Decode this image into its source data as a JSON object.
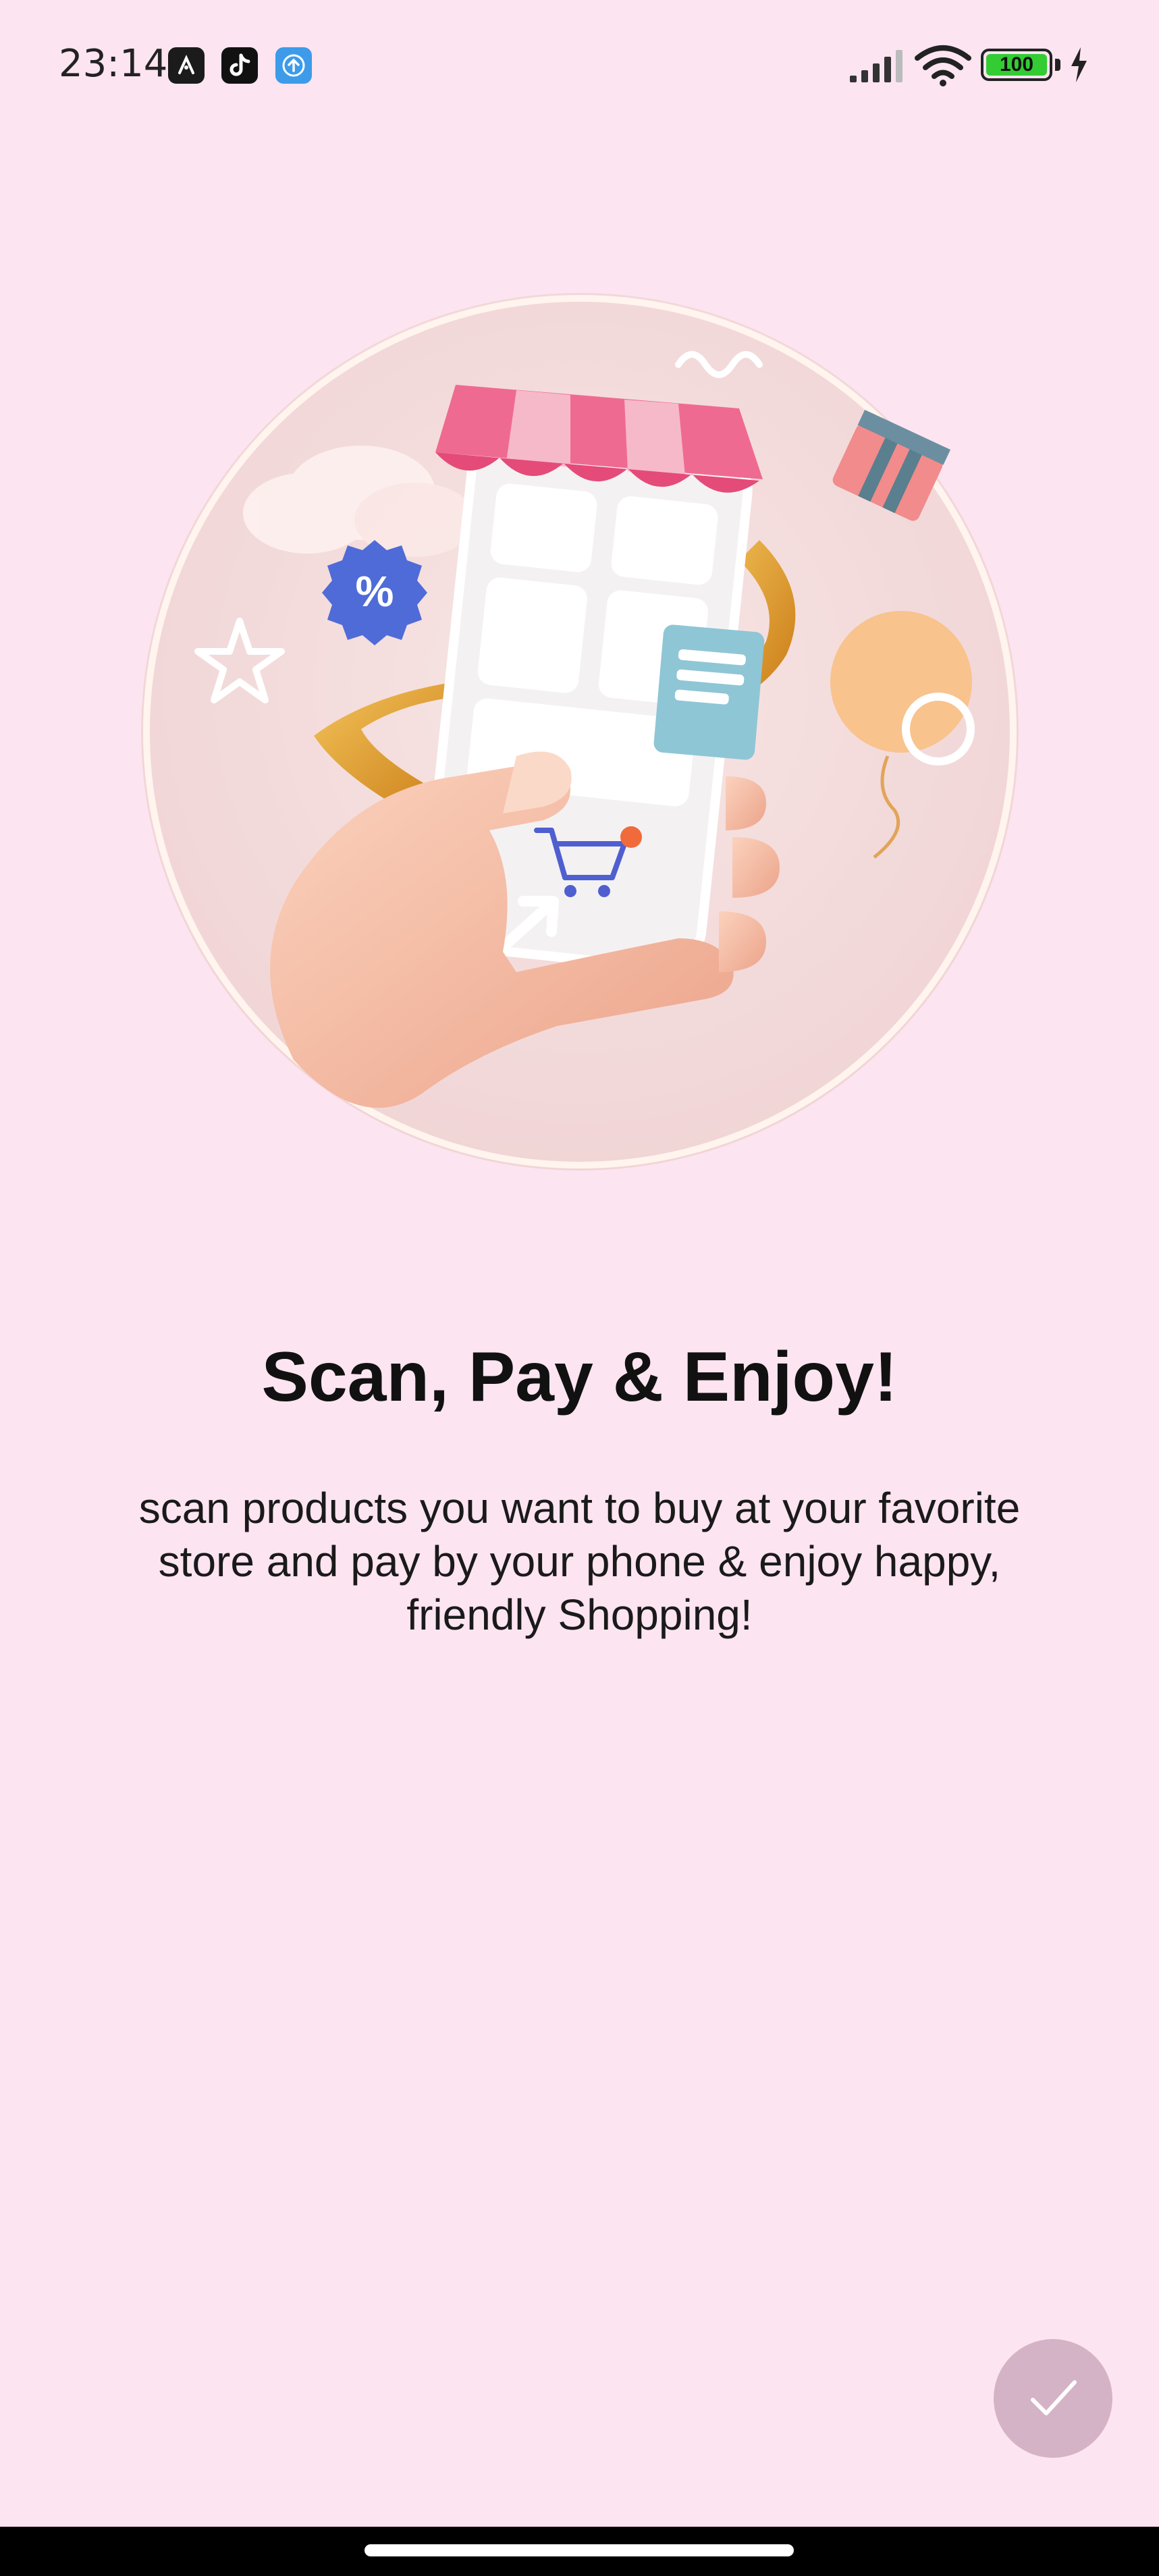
{
  "status_bar": {
    "time": "23:14",
    "notification_icons": [
      "app-icon",
      "tiktok-icon",
      "upload-icon"
    ],
    "battery_level": "100",
    "signal_icon": "signal-icon",
    "wifi_icon": "wifi-icon",
    "charging_icon": "charging-icon"
  },
  "onboarding": {
    "illustration": "phone-shop-cart-illustration",
    "title": "Scan, Pay & Enjoy!",
    "description": "scan products you want to buy at your favorite store and pay by your phone & enjoy happy, friendly Shopping!",
    "done_icon": "checkmark-icon"
  },
  "colors": {
    "background": "#fde4f1",
    "done_button": "#d5b3c6",
    "awning": "#ec5f8a",
    "battery": "#33cc33"
  }
}
